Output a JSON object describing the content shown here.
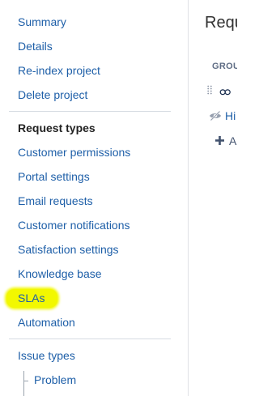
{
  "sidebar": {
    "items_top": [
      "Summary",
      "Details",
      "Re-index project",
      "Delete project"
    ],
    "section_heading": "Request types",
    "items_middle": [
      "Customer permissions",
      "Portal settings",
      "Email requests",
      "Customer notifications",
      "Satisfaction settings",
      "Knowledge base",
      "SLAs",
      "Automation"
    ],
    "items_bottom": [
      "Issue types"
    ],
    "sub_items": [
      "Problem"
    ],
    "highlight_color": "#f2f800",
    "link_color": "#1e5fa8"
  },
  "main": {
    "title": "Requ",
    "column_header": "GROU",
    "row1_text": "ထ",
    "row2_text": "Hi",
    "row3_text": "A"
  }
}
